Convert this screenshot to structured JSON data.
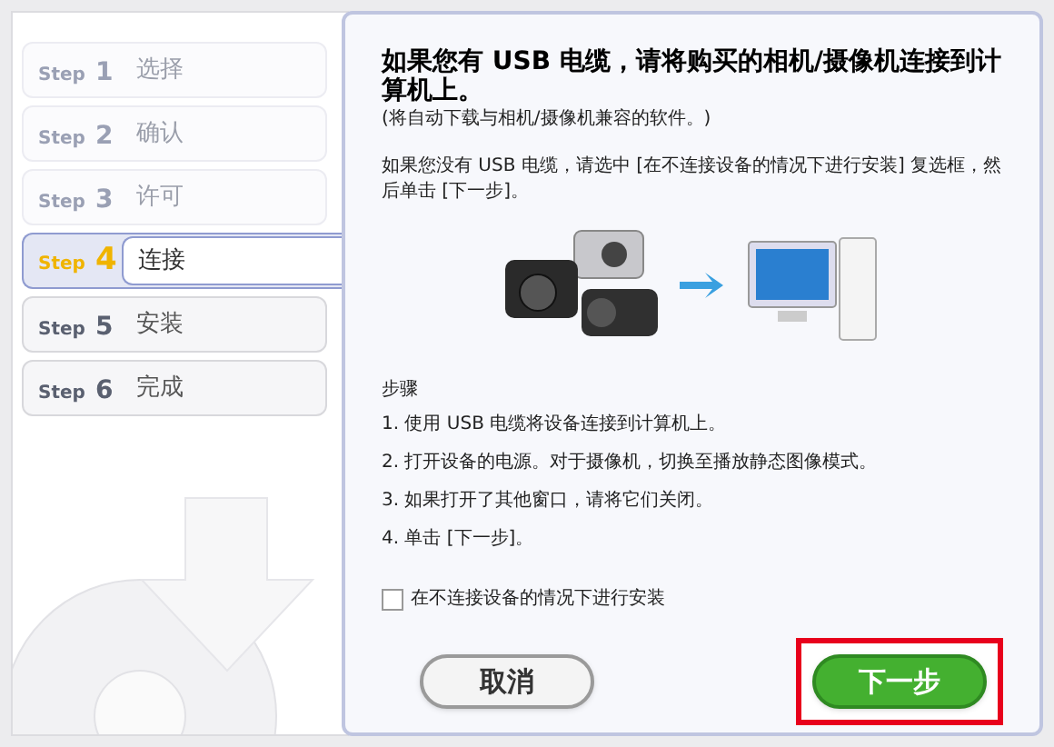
{
  "steps": [
    {
      "prefix": "Step",
      "number": "1",
      "label": "选择",
      "selected": false,
      "disabled": true
    },
    {
      "prefix": "Step",
      "number": "2",
      "label": "确认",
      "selected": false,
      "disabled": true
    },
    {
      "prefix": "Step",
      "number": "3",
      "label": "许可",
      "selected": false,
      "disabled": true
    },
    {
      "prefix": "Step",
      "number": "4",
      "label": "连接",
      "selected": true,
      "disabled": false
    },
    {
      "prefix": "Step",
      "number": "5",
      "label": "安装",
      "selected": false,
      "disabled": false
    },
    {
      "prefix": "Step",
      "number": "6",
      "label": "完成",
      "selected": false,
      "disabled": false
    }
  ],
  "content": {
    "heading": "如果您有 USB 电缆，请将购买的相机/摄像机连接到计算机上。",
    "subheading": "(将自动下载与相机/摄像机兼容的软件。)",
    "note": "如果您没有 USB 电缆，请选中 [在不连接设备的情况下进行安装] 复选框，然后单击 [下一步]。",
    "procedure_title": "步骤",
    "procedure": [
      "1. 使用 USB 电缆将设备连接到计算机上。",
      "2. 打开设备的电源。对于摄像机，切换至播放静态图像模式。",
      "3. 如果打开了其他窗口，请将它们关闭。",
      "4. 单击 [下一步]。"
    ],
    "checkbox": {
      "label": "在不连接设备的情况下进行安装",
      "checked": false
    }
  },
  "buttons": [
    {
      "label": "取消",
      "kind": "secondary",
      "highlighted": false
    },
    {
      "label": "下一步",
      "kind": "primary",
      "highlighted": true
    }
  ]
}
